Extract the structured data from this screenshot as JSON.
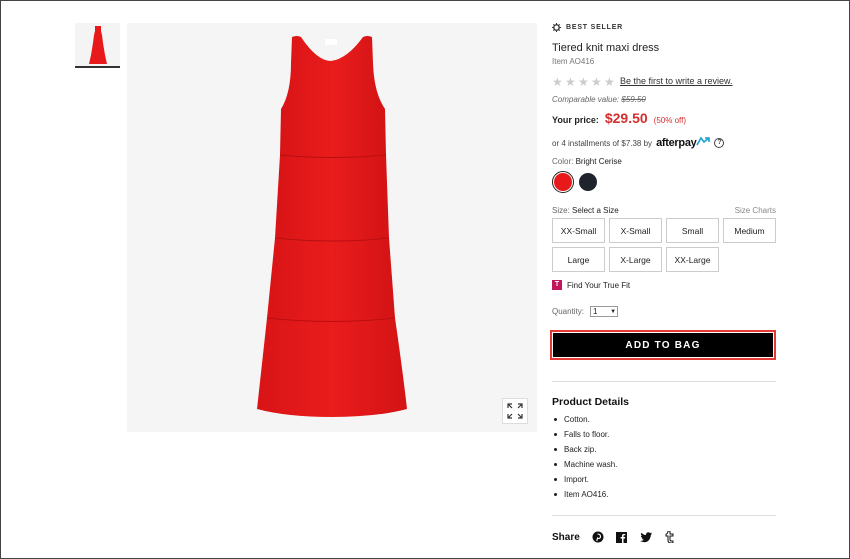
{
  "badge": {
    "label": "BEST SELLER",
    "icon": "gear-badge-icon"
  },
  "product": {
    "title": "Tiered knit maxi dress",
    "item_number": "Item AO416",
    "review_link": "Be the first to write a review.",
    "rating_stars": 0,
    "comparable_label": "Comparable value:",
    "comparable_value": "$59.50",
    "price_label": "Your price:",
    "price": "$29.50",
    "discount": "(50% off)",
    "installments": "or 4 installments of $7.38 by",
    "afterpay_logo": "afterpay",
    "color_label": "Color:",
    "color_value": "Bright Cerise",
    "swatches": [
      {
        "name": "Bright Cerise",
        "hex": "#e8191a",
        "selected": true
      },
      {
        "name": "Navy",
        "hex": "#1f232b",
        "selected": false
      }
    ],
    "size_label": "Size:",
    "size_value": "Select a Size",
    "size_charts": "Size Charts",
    "sizes": [
      "XX-Small",
      "X-Small",
      "Small",
      "Medium",
      "Large",
      "X-Large",
      "XX-Large"
    ],
    "truefit_label": "Find Your True Fit",
    "truefit_icon_letter": "T",
    "quantity_label": "Quantity:",
    "quantity_value": "1",
    "add_to_bag": "ADD TO BAG"
  },
  "details": {
    "title": "Product Details",
    "items": [
      "Cotton.",
      "Falls to floor.",
      "Back zip.",
      "Machine wash.",
      "Import.",
      "Item AO416."
    ]
  },
  "share": {
    "label": "Share",
    "icons": [
      "pinterest-icon",
      "facebook-icon",
      "twitter-icon",
      "tumblr-icon"
    ]
  },
  "colors": {
    "dress": "#e8191a",
    "price_red": "#d32f2f",
    "button_black": "#000000",
    "focus_outline": "#e53935"
  }
}
